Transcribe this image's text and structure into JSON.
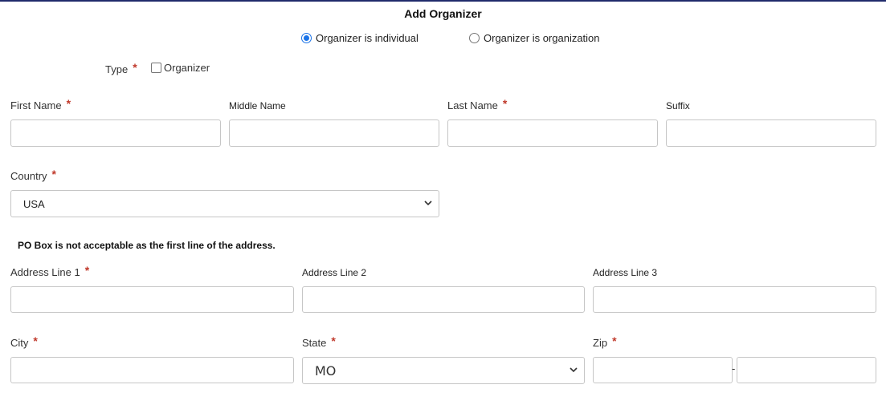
{
  "form": {
    "title": "Add Organizer",
    "organizer_type": {
      "options": [
        {
          "label": "Organizer is individual",
          "selected": true
        },
        {
          "label": "Organizer is organization",
          "selected": false
        }
      ]
    },
    "type": {
      "label": "Type",
      "required_mark": "*",
      "checkbox_label": "Organizer",
      "checked": false
    },
    "name": {
      "first": {
        "label": "First Name",
        "required_mark": "*",
        "value": ""
      },
      "middle": {
        "label": "Middle Name",
        "value": ""
      },
      "last": {
        "label": "Last Name",
        "required_mark": "*",
        "value": ""
      },
      "suffix": {
        "label": "Suffix",
        "value": ""
      }
    },
    "country": {
      "label": "Country",
      "required_mark": "*",
      "selected": "USA"
    },
    "notice": "PO Box is not acceptable as the first line of the address.",
    "address": {
      "line1": {
        "label": "Address Line 1",
        "required_mark": "*",
        "value": ""
      },
      "line2": {
        "label": "Address Line 2",
        "value": ""
      },
      "line3": {
        "label": "Address Line 3",
        "value": ""
      }
    },
    "city": {
      "label": "City",
      "required_mark": "*",
      "value": ""
    },
    "state": {
      "label": "State",
      "required_mark": "*",
      "selected": "MO"
    },
    "zip": {
      "label": "Zip",
      "required_mark": "*",
      "separator": "-",
      "value": "",
      "ext_value": ""
    }
  },
  "colors": {
    "accent": "#1a73e8",
    "required": "#c0392b",
    "top_border": "#1f2a6b"
  }
}
